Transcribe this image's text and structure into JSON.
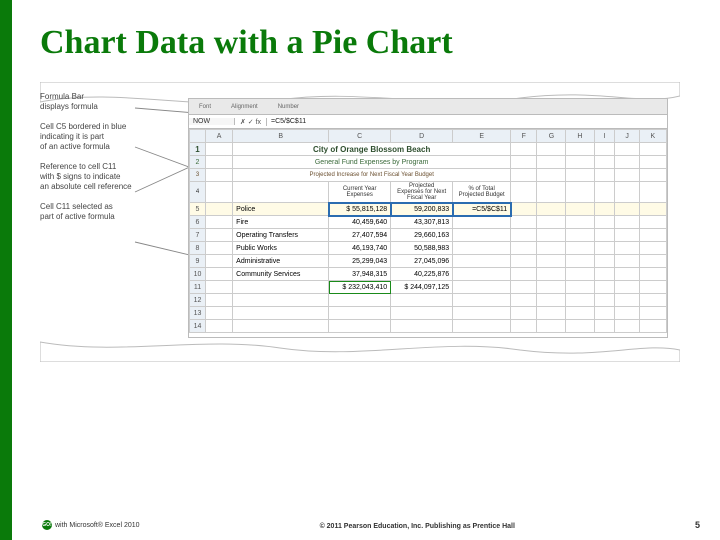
{
  "title": "Chart Data with a Pie Chart",
  "callouts": {
    "c1a": "Formula Bar",
    "c1b": "displays formula",
    "c2a": "Cell C5 bordered in blue",
    "c2b": "indicating it is part",
    "c2c": "of an active formula",
    "c3a": "Reference to cell C11",
    "c3b": "with $ signs to indicate",
    "c3c": "an absolute cell reference",
    "c4a": "Cell C11 selected as",
    "c4b": "part of active formula"
  },
  "ribbon": {
    "g1": "Font",
    "g2": "Alignment",
    "g3": "Number"
  },
  "formula": {
    "namebox": "NOW",
    "btns": "✗ ✓ fx",
    "value": "=C5/$C$11"
  },
  "headers": {
    "A": "A",
    "B": "B",
    "C": "C",
    "D": "D",
    "E": "E",
    "F": "F",
    "G": "G",
    "H": "H",
    "I": "I",
    "J": "J",
    "K": "K"
  },
  "rows": {
    "t1": "City of Orange Blossom Beach",
    "t2": "General Fund Expenses by Program",
    "t3": "Projected Increase for Next Fiscal Year Budget",
    "h_curr": "Current Year Expenses",
    "h_proj_a": "Projected",
    "h_proj_b": "Expenses for Next",
    "h_proj_c": "Fiscal Year",
    "h_pct_a": "% of Total",
    "h_pct_b": "Projected Budget",
    "r5_b": "Police",
    "r5_c": "$ 55,815,128",
    "r5_d": "59,200,833",
    "r5_e": "=C5/$C$11",
    "r6_b": "Fire",
    "r6_c": "40,459,640",
    "r6_d": "43,307,813",
    "r7_b": "Operating Transfers",
    "r7_c": "27,407,594",
    "r7_d": "29,660,163",
    "r8_b": "Public Works",
    "r8_c": "46,193,740",
    "r8_d": "50,588,983",
    "r9_b": "Administrative",
    "r9_c": "25,299,043",
    "r9_d": "27,045,096",
    "r10_b": "Community Services",
    "r10_c": "37,948,315",
    "r10_d": "40,225,876",
    "r11_c": "$ 232,043,410",
    "r11_d": "$ 244,097,125"
  },
  "rn": {
    "r1": "1",
    "r2": "2",
    "r3": "3",
    "r4": "4",
    "r5": "5",
    "r6": "6",
    "r7": "7",
    "r8": "8",
    "r9": "9",
    "r10": "10",
    "r11": "11",
    "r12": "12",
    "r13": "13",
    "r14": "14"
  },
  "footer": {
    "left": "with Microsoft® Excel 2010",
    "logo": "GO!",
    "center": "© 2011 Pearson Education, Inc. Publishing as Prentice Hall",
    "page": "5"
  }
}
